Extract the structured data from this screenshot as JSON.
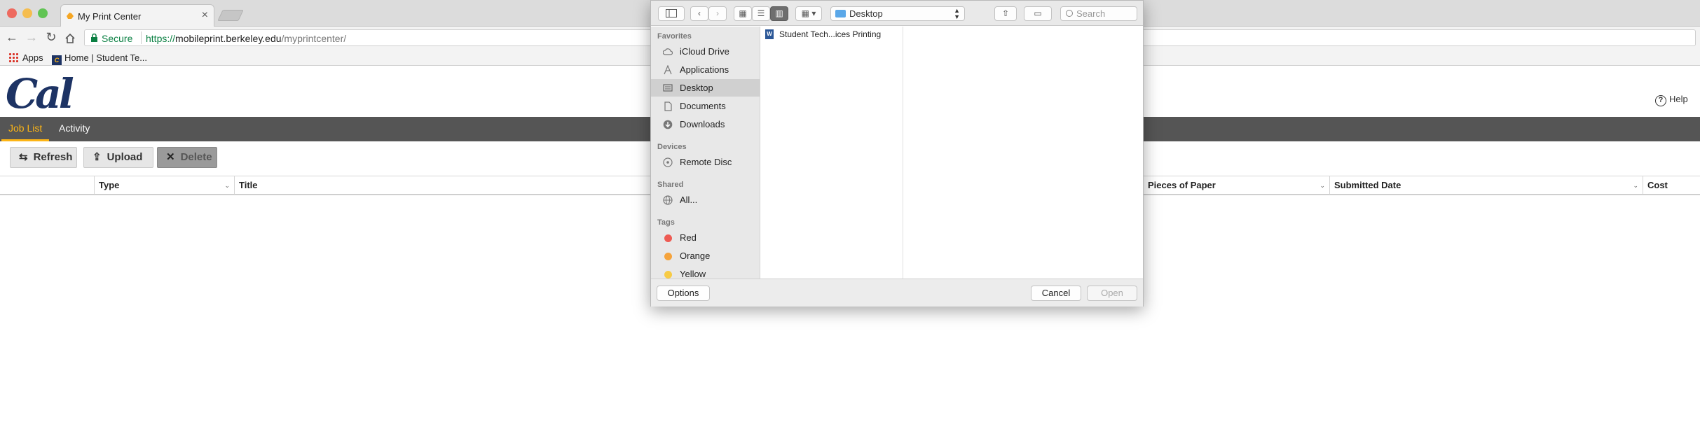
{
  "browser": {
    "tab_title": "My Print Center",
    "tab_close": "×",
    "address": {
      "secure_label": "Secure",
      "scheme": "https://",
      "host": "mobileprint.berkeley.edu",
      "path": "/myprintcenter/"
    },
    "bookmarks": [
      {
        "label": "Apps"
      },
      {
        "label": "Home | Student Te..."
      }
    ]
  },
  "page": {
    "logo": "Cal",
    "help_label": "Help",
    "nav_tabs": [
      {
        "label": "Job List",
        "active": true
      },
      {
        "label": "Activity",
        "active": false
      }
    ],
    "actions": {
      "refresh": "Refresh",
      "upload": "Upload",
      "delete": "Delete"
    },
    "table_columns": [
      "Type",
      "Title",
      "Pieces of Paper",
      "Submitted Date",
      "Cost"
    ]
  },
  "dialog": {
    "location": "Desktop",
    "search_placeholder": "Search",
    "sidebar": {
      "favorites_header": "Favorites",
      "favorites": [
        "iCloud Drive",
        "Applications",
        "Desktop",
        "Documents",
        "Downloads"
      ],
      "selected": "Desktop",
      "devices_header": "Devices",
      "devices": [
        "Remote Disc"
      ],
      "shared_header": "Shared",
      "shared": [
        "All..."
      ],
      "tags_header": "Tags",
      "tags": [
        {
          "name": "Red",
          "color": "#ee5b53"
        },
        {
          "name": "Orange",
          "color": "#f5a33c"
        },
        {
          "name": "Yellow",
          "color": "#f7cb45"
        }
      ]
    },
    "files": [
      "Student Tech...ices Printing"
    ],
    "buttons": {
      "options": "Options",
      "cancel": "Cancel",
      "open": "Open"
    }
  }
}
